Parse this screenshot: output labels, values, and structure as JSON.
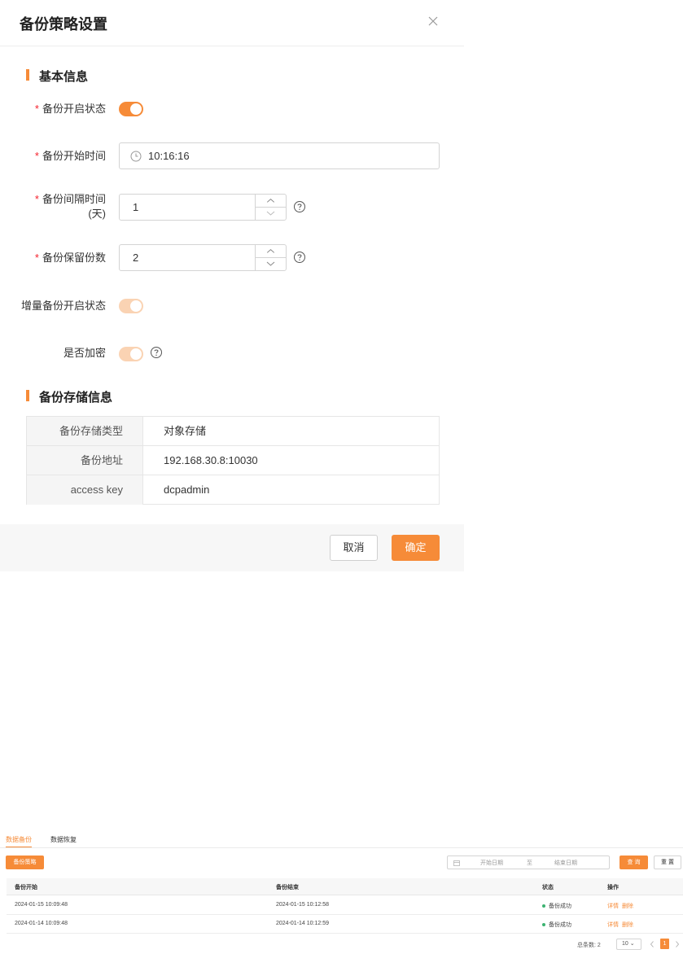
{
  "modal": {
    "title": "备份策略设置",
    "sections": {
      "basic": "基本信息",
      "storage": "备份存储信息"
    },
    "fields": {
      "backup_enabled": {
        "label": "备份开启状态",
        "required": "*",
        "value": true
      },
      "start_time": {
        "label": "备份开始时间",
        "required": "*",
        "value": "10:16:16"
      },
      "interval_days": {
        "label_line1": "备份间隔时间",
        "label_line2": "(天)",
        "required": "*",
        "value": "1"
      },
      "keep_copies": {
        "label": "备份保留份数",
        "required": "*",
        "value": "2"
      },
      "incremental_enabled": {
        "label": "增量备份开启状态",
        "value": true
      },
      "encrypted": {
        "label": "是否加密",
        "value": true
      }
    },
    "storage_info": [
      {
        "key": "备份存储类型",
        "value": "对象存储"
      },
      {
        "key": "备份地址",
        "value": "192.168.30.8:10030"
      },
      {
        "key": "access key",
        "value": "dcpadmin"
      }
    ],
    "footer": {
      "cancel": "取消",
      "ok": "确定"
    }
  },
  "list_page": {
    "tabs": [
      {
        "label": "数据备份",
        "active": true
      },
      {
        "label": "数据恢复",
        "active": false
      }
    ],
    "policy_button": "备份策略",
    "date_range": {
      "start_placeholder": "开始日期",
      "separator": "至",
      "end_placeholder": "结束日期"
    },
    "query_button": "查 询",
    "reset_button": "重 置",
    "columns": [
      "备份开始",
      "备份结束",
      "状态",
      "操作"
    ],
    "rows": [
      {
        "start": "2024-01-15 10:09:48",
        "end": "2024-01-15 10:12:58",
        "status": "备份成功",
        "ops": [
          "详情",
          "删除"
        ]
      },
      {
        "start": "2024-01-14 10:09:48",
        "end": "2024-01-14 10:12:59",
        "status": "备份成功",
        "ops": [
          "详情",
          "删除"
        ]
      }
    ],
    "pagination": {
      "total_label": "总条数: 2",
      "page_size": "10",
      "current_page": "1"
    }
  },
  "colors": {
    "accent": "#f68b38",
    "success": "#3cb371",
    "required": "#f5222d"
  }
}
